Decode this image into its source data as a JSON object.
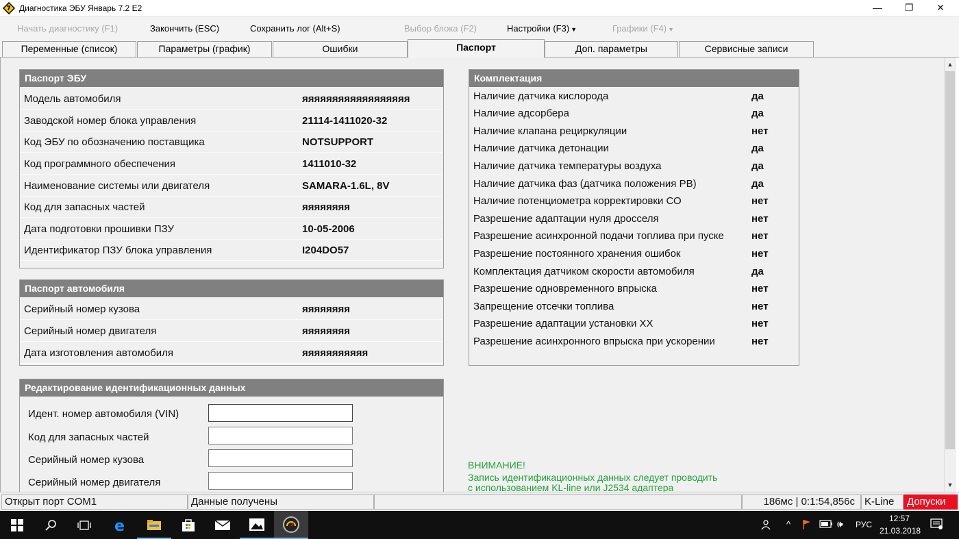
{
  "window": {
    "title": "Диагностика ЭБУ Январь 7.2 E2",
    "minimize": "—",
    "restore": "❐",
    "close": "✕"
  },
  "toolbar": {
    "start": "Начать диагностику (F1)",
    "finish": "Закончить (ESC)",
    "save_log": "Сохранить лог (Alt+S)",
    "select_block": "Выбор блока (F2)",
    "settings": "Настройки (F3)",
    "graphs": "Графики (F4)"
  },
  "tabs": [
    {
      "label": "Переменные (список)",
      "active": false
    },
    {
      "label": "Параметры (график)",
      "active": false
    },
    {
      "label": "Ошибки",
      "active": false
    },
    {
      "label": "Паспорт",
      "active": true
    },
    {
      "label": "Доп. параметры",
      "active": false
    },
    {
      "label": "Сервисные записи",
      "active": false
    }
  ],
  "ecu_passport": {
    "title": "Паспорт ЭБУ",
    "rows": [
      {
        "label": "Модель автомобиля",
        "value": "яяяяяяяяяяяяяяяяяя"
      },
      {
        "label": "Заводской номер блока управления",
        "value": "21114-1411020-32"
      },
      {
        "label": "Код ЭБУ по обозначению поставщика",
        "value": "NOTSUPPORT"
      },
      {
        "label": "Код программного обеспечения",
        "value": "1411010-32"
      },
      {
        "label": "Наименование системы или двигателя",
        "value": "SAMARA-1.6L, 8V"
      },
      {
        "label": "Код для запасных частей",
        "value": "яяяяяяяя"
      },
      {
        "label": "Дата подготовки прошивки ПЗУ",
        "value": "10-05-2006"
      },
      {
        "label": "Идентификатор ПЗУ блока управления",
        "value": "I204DO57"
      }
    ]
  },
  "car_passport": {
    "title": "Паспорт автомобиля",
    "rows": [
      {
        "label": "Серийный номер кузова",
        "value": "яяяяяяяя"
      },
      {
        "label": "Серийный номер двигателя",
        "value": "яяяяяяяя"
      },
      {
        "label": "Дата изготовления автомобиля",
        "value": "яяяяяяяяяяя"
      }
    ]
  },
  "edit_ids": {
    "title": "Редактирование идентификационных данных",
    "fields": [
      {
        "label": "Идент. номер автомобиля (VIN)",
        "value": ""
      },
      {
        "label": "Код для запасных частей",
        "value": ""
      },
      {
        "label": "Серийный номер кузова",
        "value": ""
      },
      {
        "label": "Серийный номер двигателя",
        "value": ""
      }
    ]
  },
  "equipment": {
    "title": "Комплектация",
    "rows": [
      {
        "label": "Наличие датчика кислорода",
        "value": "да"
      },
      {
        "label": "Наличие адсорбера",
        "value": "да"
      },
      {
        "label": "Наличие клапана рециркуляции",
        "value": "нет"
      },
      {
        "label": "Наличие датчика детонации",
        "value": "да"
      },
      {
        "label": "Наличие датчика температуры воздуха",
        "value": "да"
      },
      {
        "label": "Наличие датчика фаз (датчика положения РВ)",
        "value": "да"
      },
      {
        "label": "Наличие потенциометра корректировки СО",
        "value": "нет"
      },
      {
        "label": "Разрешение адаптации нуля дросселя",
        "value": "нет"
      },
      {
        "label": "Разрешение асинхронной подачи топлива при пуске",
        "value": "нет"
      },
      {
        "label": "Разрешение постоянного хранения ошибок",
        "value": "нет"
      },
      {
        "label": "Комплектация датчиком скорости автомобиля",
        "value": "да"
      },
      {
        "label": "Разрешение одновременного впрыска",
        "value": "нет"
      },
      {
        "label": "Запрещение отсечки топлива",
        "value": "нет"
      },
      {
        "label": "Разрешение адаптации установки ХХ",
        "value": "нет"
      },
      {
        "label": "Разрешение асинхронного впрыска при ускорении",
        "value": "нет"
      }
    ]
  },
  "warning": {
    "title": "ВНИМАНИЕ!",
    "line1": "Запись идентификационных данных следует проводить",
    "line2": "с использованием KL-line или J2534 адаптера"
  },
  "status": {
    "port": "Открыт порт COM1",
    "data": "Данные получены",
    "timing": "186мс | 0:1:54,856с",
    "protocol": "K-Line",
    "access": "Допуски",
    "access_color": "#e81123"
  },
  "taskbar": {
    "lang": "РУС",
    "time": "12:57",
    "date": "21.03.2018",
    "icons": [
      "windows-start-icon",
      "search-icon",
      "task-view-icon",
      "edge-icon",
      "file-explorer-icon",
      "store-icon",
      "mail-icon",
      "photos-icon",
      "diagnostic-app-icon"
    ]
  }
}
